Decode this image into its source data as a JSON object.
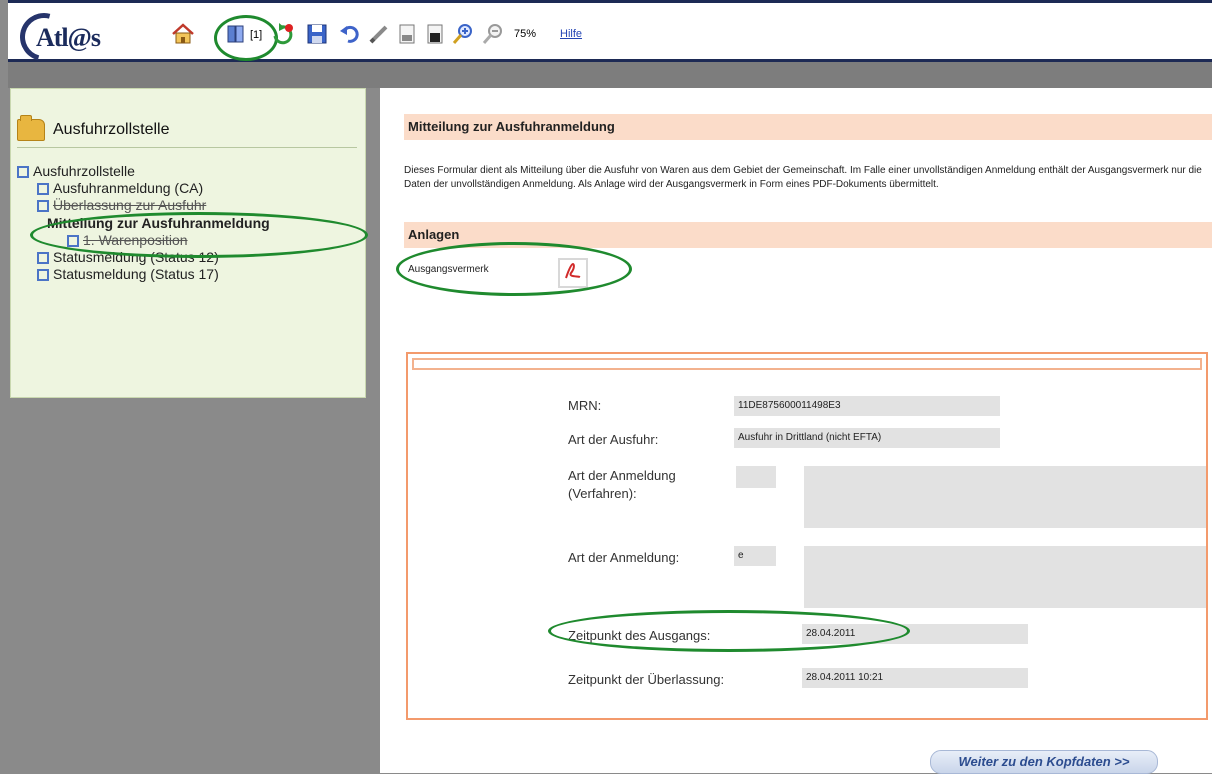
{
  "app": {
    "logo_text": "Atl@s"
  },
  "toolbar": {
    "tree_count": "[1]",
    "zoom": "75%",
    "help_label": "Hilfe"
  },
  "tree": {
    "title": "Ausfuhrzollstelle",
    "items": [
      {
        "label": "Ausfuhrzollstelle"
      },
      {
        "label": "Ausfuhranmeldung  (CA)"
      },
      {
        "label": "Überlassung zur Ausfuhr"
      },
      {
        "label": "Mitteilung zur Ausfuhranmeldung"
      },
      {
        "label": "1. Warenposition"
      },
      {
        "label": "Statusmeldung (Status 12)"
      },
      {
        "label": "Statusmeldung (Status 17)"
      }
    ]
  },
  "main": {
    "header": "Mitteilung zur Ausfuhranmeldung",
    "description": "Dieses Formular dient als Mitteilung über die Ausfuhr von Waren aus dem Gebiet der Gemeinschaft. Im Falle einer unvollständigen Anmeldung enthält der Ausgangsvermerk nur die Daten der unvollständigen Anmeldung. Als Anlage wird der Ausgangsvermerk in Form eines PDF-Dokuments übermittelt.",
    "attachments_header": "Anlagen",
    "attachment_label": "Ausgangsvermerk",
    "fields": {
      "mrn_label": "MRN:",
      "mrn_value": "11DE875600011498E3",
      "art_ausfuhr_label": "Art der Ausfuhr:",
      "art_ausfuhr_value": "Ausfuhr in Drittland (nicht EFTA)",
      "art_anmeldung_verfahren_label_1": "Art der Anmeldung",
      "art_anmeldung_verfahren_label_2": "(Verfahren):",
      "art_anmeldung_label": "Art der Anmeldung:",
      "art_anmeldung_value": "e",
      "zeitpunkt_ausgang_label": "Zeitpunkt des Ausgangs:",
      "zeitpunkt_ausgang_value": "28.04.2011",
      "zeitpunkt_ueberlassung_label": "Zeitpunkt der Überlassung:",
      "zeitpunkt_ueberlassung_value": "28.04.2011 10:21"
    },
    "next_button": "Weiter zu den Kopfdaten  >>"
  },
  "colors": {
    "section_bar": "#fbdcc9",
    "form_border": "#f39a6c",
    "highlight": "#1f8a2e",
    "tree_bg": "#eef5e0"
  }
}
